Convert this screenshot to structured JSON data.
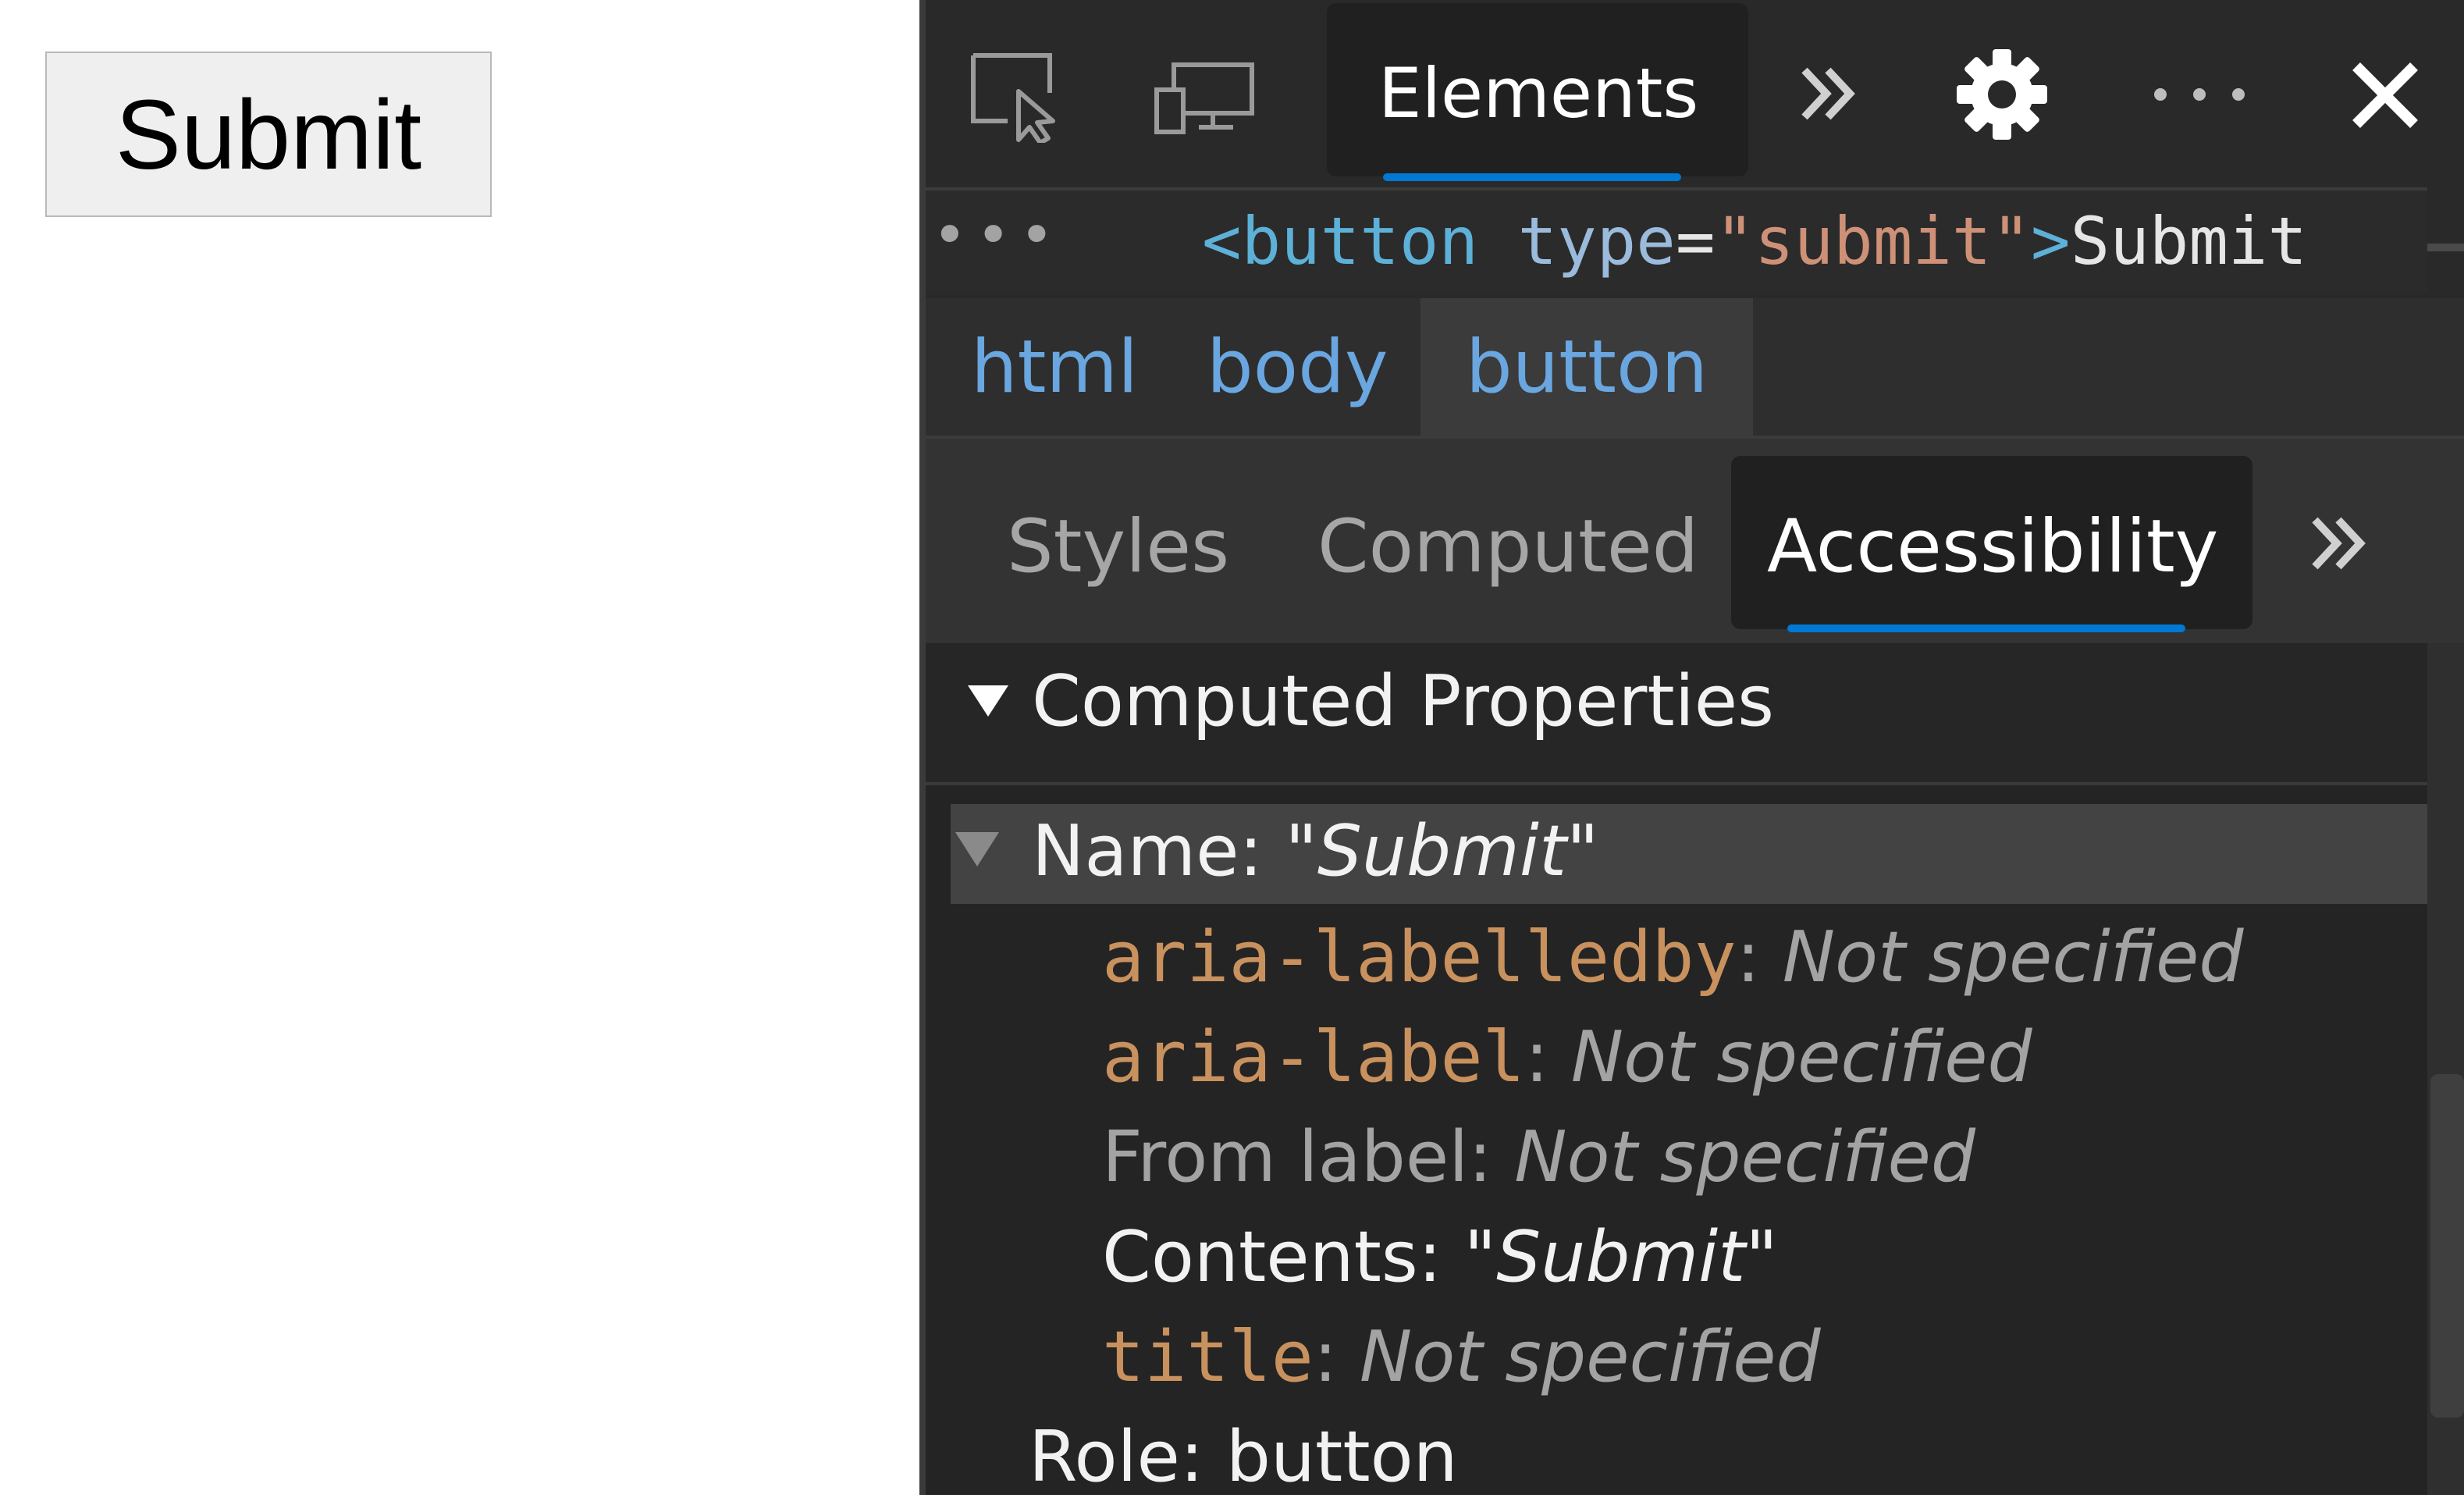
{
  "page": {
    "submit_label": "Submit"
  },
  "devtools": {
    "toolbar": {
      "inspect_icon": "inspect-element-icon",
      "device_icon": "device-emulation-icon",
      "elements_tab": "Elements",
      "more_tabs_icon": "chevron-double-right-icon",
      "settings_icon": "gear-icon",
      "more_icon": "ellipsis-icon",
      "close_icon": "close-icon"
    },
    "dom": {
      "ellipsis": "•••",
      "open": "<",
      "tag": "button",
      "attr": "type",
      "eq": "=",
      "value": "\"submit\"",
      "close": ">",
      "text": "Submit"
    },
    "breadcrumbs": [
      "html",
      "body",
      "button"
    ],
    "subtabs": {
      "styles": "Styles",
      "computed": "Computed",
      "accessibility": "Accessibility"
    },
    "accessibility": {
      "section_title": "Computed Properties",
      "name_label": "Name: \"",
      "name_value": "Submit",
      "name_end": "\"",
      "aria_labelledby": "aria-labelledby",
      "aria_label": "aria-label",
      "from_label": "From label: ",
      "contents_label": "Contents: \"",
      "contents_value": "Submit",
      "contents_end": "\"",
      "title_attr": "title",
      "not_specified": "Not specified",
      "colon": ": ",
      "role_label": "Role: ",
      "role_value": "button"
    },
    "colors": {
      "accent": "#0078d4",
      "attr_orange": "#c8915e",
      "link_blue": "#6aa6df"
    }
  }
}
